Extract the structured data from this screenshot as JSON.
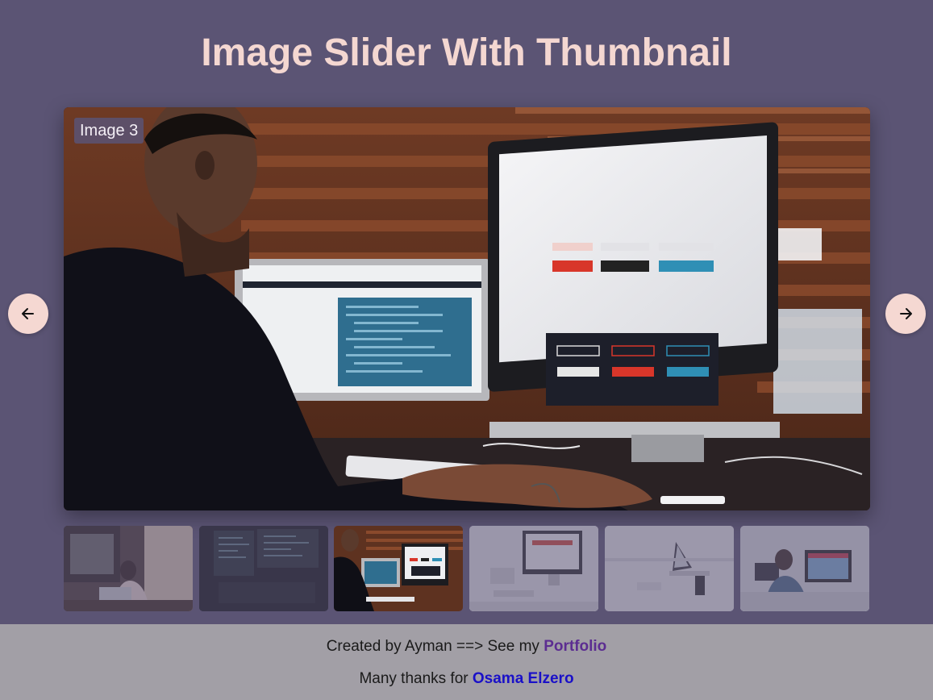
{
  "header": {
    "title": "Image Slider With Thumbnail"
  },
  "slider": {
    "caption": "Image 3",
    "current_index": 3,
    "total": 6,
    "prev_icon": "arrow-left-icon",
    "next_icon": "arrow-right-icon"
  },
  "thumbnails": [
    {
      "subject": "woman-at-laptop-in-cafe"
    },
    {
      "subject": "code-on-dark-monitors"
    },
    {
      "subject": "man-at-dual-monitors"
    },
    {
      "subject": "white-desk-with-imac"
    },
    {
      "subject": "laptop-on-white-desk"
    },
    {
      "subject": "man-at-monitor-in-office"
    }
  ],
  "footer": {
    "line1_prefix": "Created by Ayman ==> See my ",
    "line1_link": "Portfolio",
    "line2_prefix": "Many thanks for ",
    "line2_link": "Osama Elzero"
  },
  "colors": {
    "background": "#5b5474",
    "title": "#f4d7d1",
    "nav_button": "#f5d8d2",
    "footer_bg": "#a29fa6",
    "portfolio_link": "#5c2d91",
    "credit_link": "#1a10c8"
  }
}
